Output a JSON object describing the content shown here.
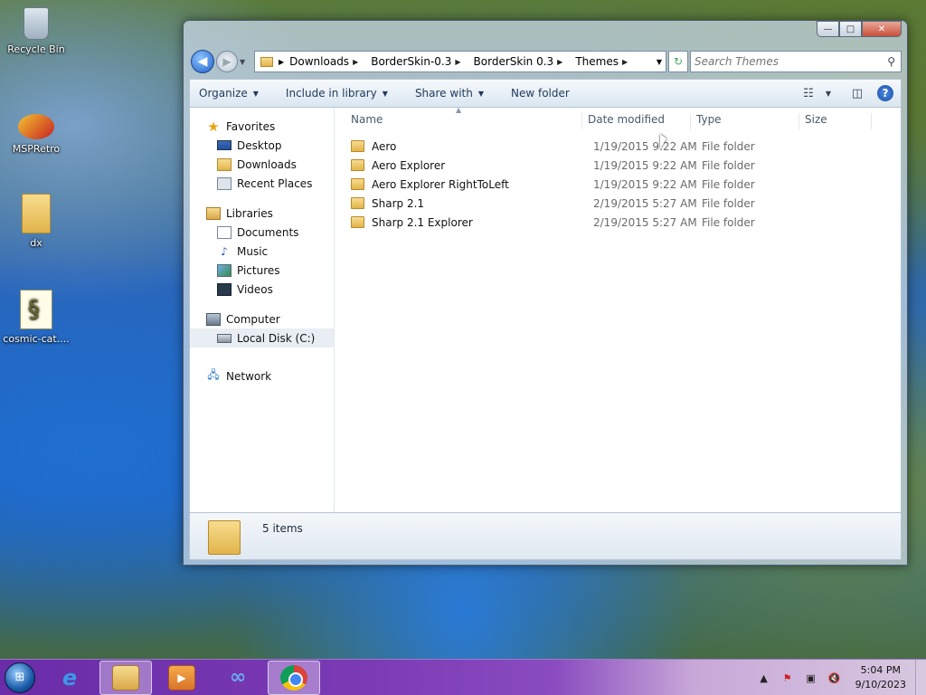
{
  "desktop": {
    "icons": [
      {
        "label": "Recycle Bin",
        "icon": "recycle-bin-icon"
      },
      {
        "label": "MSPRetro",
        "icon": "msp-retro-icon"
      },
      {
        "label": "dx",
        "icon": "folder-icon"
      },
      {
        "label": "cosmic-cat....",
        "icon": "script-file-icon"
      }
    ]
  },
  "window": {
    "caption_buttons": {
      "minimize": "—",
      "maximize": "□",
      "close": "✕"
    },
    "address": {
      "crumbs": [
        "Downloads",
        "BorderSkin-0.3",
        "BorderSkin 0.3",
        "Themes"
      ]
    },
    "search": {
      "placeholder": "Search Themes"
    },
    "toolbar": {
      "organize": "Organize",
      "include_in_library": "Include in library",
      "share_with": "Share with",
      "new_folder": "New folder"
    },
    "nav": {
      "favorites": "Favorites",
      "desktop": "Desktop",
      "downloads": "Downloads",
      "recent_places": "Recent Places",
      "libraries": "Libraries",
      "documents": "Documents",
      "music": "Music",
      "pictures": "Pictures",
      "videos": "Videos",
      "computer": "Computer",
      "local_disk": "Local Disk (C:)",
      "network": "Network"
    },
    "columns": {
      "name": "Name",
      "date_modified": "Date modified",
      "type": "Type",
      "size": "Size"
    },
    "files": [
      {
        "name": "Aero",
        "date": "1/19/2015 9:22 AM",
        "type": "File folder"
      },
      {
        "name": "Aero Explorer",
        "date": "1/19/2015 9:22 AM",
        "type": "File folder"
      },
      {
        "name": "Aero Explorer RightToLeft",
        "date": "1/19/2015 9:22 AM",
        "type": "File folder"
      },
      {
        "name": "Sharp 2.1",
        "date": "2/19/2015 5:27 AM",
        "type": "File folder"
      },
      {
        "name": "Sharp 2.1 Explorer",
        "date": "2/19/2015 5:27 AM",
        "type": "File folder"
      }
    ],
    "status": {
      "item_count": "5 items"
    }
  },
  "taskbar": {
    "clock": {
      "time": "5:04 PM",
      "date": "9/10/2023"
    },
    "apps": [
      "internet-explorer-icon",
      "file-explorer-icon",
      "media-player-icon",
      "infinity-app-icon",
      "chrome-icon"
    ]
  }
}
